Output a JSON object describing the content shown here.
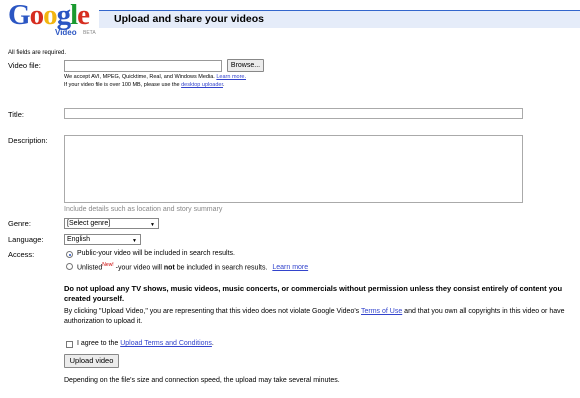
{
  "header": {
    "logo_text": "Google",
    "logo_sub": "Video",
    "logo_beta": "BETA",
    "title": "Upload and share your videos"
  },
  "form": {
    "required_note": "All fields are required.",
    "file": {
      "label": "Video file:",
      "browse_label": "Browse...",
      "accept_text": "We accept AVI, MPEG, Quicktime, Real, and Windows Media.",
      "accept_link": "Learn more.",
      "large_text": "If your video file is over 100 MB, please use the",
      "large_link": "desktop uploader",
      "large_end": "."
    },
    "title": {
      "label": "Title:",
      "value": ""
    },
    "description": {
      "label": "Description:",
      "value": "",
      "hint": "Include details such as location and story summary"
    },
    "genre": {
      "label": "Genre:",
      "selected": "[Select genre]"
    },
    "language": {
      "label": "Language:",
      "selected": "English"
    },
    "access": {
      "label": "Access:",
      "public_text": "Public-your video will be included in search results.",
      "unlisted_a": "Unlisted",
      "unlisted_new": "New!",
      "unlisted_b": " -your video will ",
      "unlisted_not": "not",
      "unlisted_c": " be included in search results.",
      "unlisted_link": "Learn more",
      "selected": "public"
    },
    "warning": "Do not upload any TV shows, music videos, music concerts, or commercials without permission unless they consist entirely of content you created yourself.",
    "terms": {
      "pre": "By clicking \"Upload Video,\" you are representing that this video does not violate Google Video's ",
      "link": "Terms of Use",
      "post": " and that you own all copyrights in this video or have authorization to upload it."
    },
    "agree": {
      "pre": "I agree to the ",
      "link": "Upload Terms and Conditions",
      "post": ".",
      "checked": false
    },
    "upload_label": "Upload video",
    "footer_note": "Depending on the file's size and connection speed, the upload may take several minutes."
  }
}
